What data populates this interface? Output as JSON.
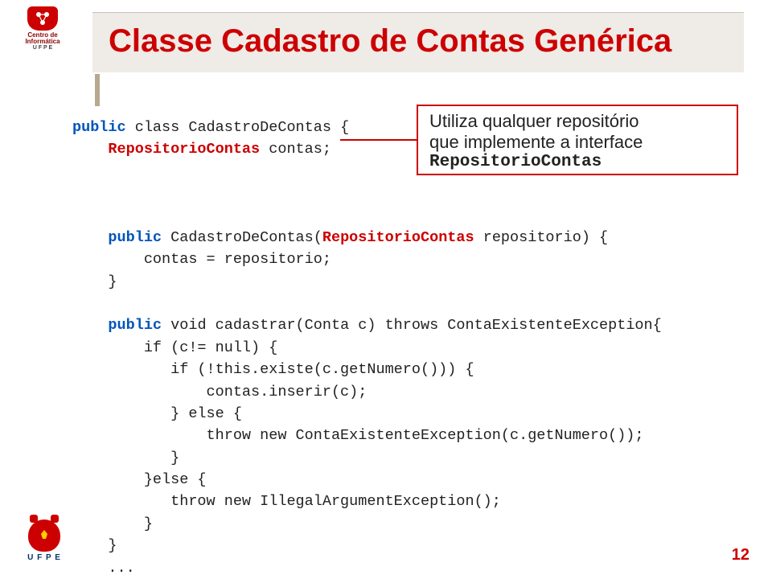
{
  "title": "Classe Cadastro de Contas Genérica",
  "callout": {
    "line1": "Utiliza qualquer repositório",
    "line2": "que implemente a interface",
    "repo": "RepositorioContas"
  },
  "code": {
    "l1a": "public",
    "l1b": " class CadastroDeContas {",
    "l2a": "    RepositorioContas",
    "l2b": " contas;",
    "l3a": "    public",
    "l3b": " CadastroDeContas(",
    "l3c": "RepositorioContas",
    "l3d": " repositorio) {",
    "l4": "        contas = repositorio;",
    "l5": "    }",
    "l6a": "    public",
    "l6b": " void cadastrar(Conta c) throws ContaExistenteException{",
    "l7": "        if (c!= null) {",
    "l8": "           if (!this.existe(c.getNumero())) {",
    "l9": "               contas.inserir(c);",
    "l10": "           } else {",
    "l11": "               throw new ContaExistenteException(c.getNumero());",
    "l12": "           }",
    "l13": "        }else {",
    "l14": "           throw new IllegalArgumentException();",
    "l15": "        }",
    "l16": "    }",
    "l17": "    ..."
  },
  "page_number": "12",
  "logo_top_text1": "Centro de",
  "logo_top_text2": "Informática",
  "logo_top_sub": "U F P E",
  "logo_bottom_text": "U F P E"
}
